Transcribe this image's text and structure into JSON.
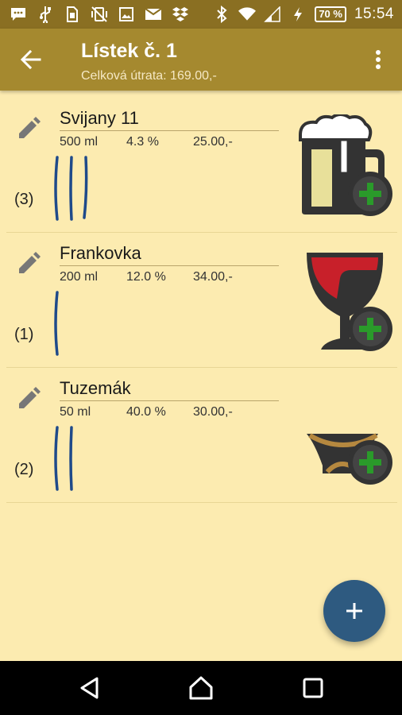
{
  "status_bar": {
    "time": "15:54",
    "battery": "70 %",
    "icons_left": [
      "message-icon",
      "usb-icon",
      "sim-icon",
      "vibrate-off-icon",
      "image-icon",
      "mail-icon",
      "dropbox-icon"
    ],
    "icons_right": [
      "bluetooth-icon",
      "wifi-icon",
      "signal-icon",
      "charging-icon"
    ]
  },
  "toolbar": {
    "title": "Lístek č. 1",
    "subtitle": "Celková útrata: 169.00,-"
  },
  "items": [
    {
      "name": "Svijany 11",
      "volume": "500 ml",
      "abv": "4.3 %",
      "price": "25.00,-",
      "count": "(3)",
      "tally": 3,
      "drink": "beer"
    },
    {
      "name": "Frankovka",
      "volume": "200 ml",
      "abv": "12.0 %",
      "price": "34.00,-",
      "count": "(1)",
      "tally": 1,
      "drink": "wine"
    },
    {
      "name": "Tuzemák",
      "volume": "50 ml",
      "abv": "40.0 %",
      "price": "30.00,-",
      "count": "(2)",
      "tally": 2,
      "drink": "shot"
    }
  ],
  "colors": {
    "background": "#fcebb0",
    "toolbar": "#a5892f",
    "status_bar": "#8a6f22",
    "fab": "#2e5a80",
    "plus_badge": "#2a9a2a",
    "tally": "#1f4a8a"
  }
}
